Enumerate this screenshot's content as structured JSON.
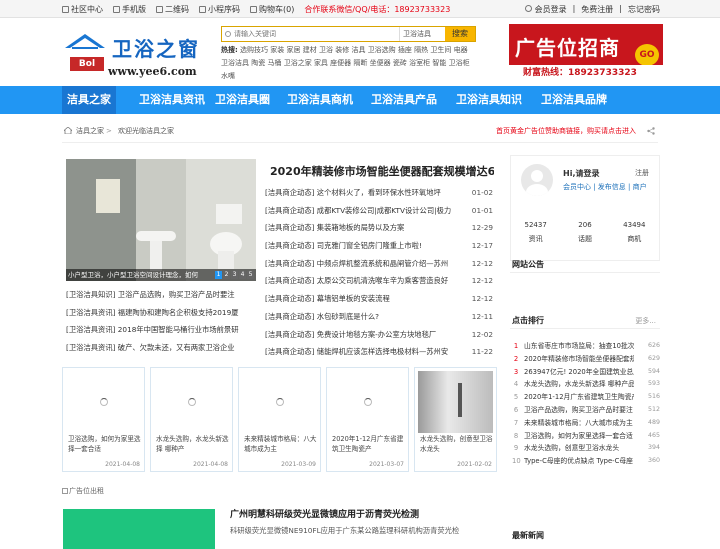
{
  "topbar": {
    "left": [
      "社区中心",
      "手机版",
      "二维码",
      "小程序码",
      "购物车(0)"
    ],
    "hotline": "合作联系微信/QQ/电话：18923733323",
    "right": [
      "会员登录",
      "免费注册",
      "忘记密码"
    ]
  },
  "logo": {
    "name": "卫浴之窗",
    "url": "www.yee6.com",
    "badge": "Bol"
  },
  "search": {
    "placeholder": "请输入关键词",
    "category": "卫浴洁具",
    "button": "搜索"
  },
  "hot": {
    "label": "热搜:",
    "items": [
      "选购技巧",
      "家装",
      "家居",
      "建材",
      "卫浴",
      "装修",
      "洁具",
      "卫浴选购",
      "插座",
      "隔热",
      "卫生间",
      "电器",
      "卫浴洁具",
      "陶瓷",
      "马桶",
      "卫浴之家",
      "家具",
      "座便器",
      "隔断",
      "坐便器",
      "瓷砖",
      "浴室柜",
      "智能",
      "卫浴柜",
      "水嘴"
    ]
  },
  "ad_banner": {
    "title": "广告位招商",
    "phone": "财富热线：18923733323",
    "go": "GO"
  },
  "nav": [
    "洁具之家",
    "卫浴洁具资讯",
    "卫浴洁具圈",
    "卫浴洁具商机",
    "卫浴洁具产品",
    "卫浴洁具知识",
    "卫浴洁具品牌"
  ],
  "breadcrumb": {
    "home": "洁具之家",
    "sep": ">",
    "current": "欢迎光临洁具之家",
    "ad": "首页黄金广告位赞助商链接，购买请点击进入"
  },
  "slide": {
    "caption": "小户型卫浴，小户型卫浴空间设计理念，如何",
    "dots": [
      "1",
      "2",
      "3",
      "4",
      "5"
    ]
  },
  "headline": "2020年精装修市场智能坐便器配套规模增达6",
  "news": [
    {
      "title": "[洁具商企动态] 这个材料火了，看到环保水性环氧地坪",
      "date": "01-02"
    },
    {
      "title": "[洁具商企动态] 成都KTV装修公司|成都KTV设计公司|极力",
      "date": "01-01"
    },
    {
      "title": "[洁具商企动态] 集装箱地板的局势以及方案",
      "date": "12-29"
    },
    {
      "title": "[洁具商企动态] 司克雅门窗全铝房门隆重上市啦!",
      "date": "12-17"
    },
    {
      "title": "[洁具商企动态] 中频点焊机整流系统和晶闸管介绍—苏州",
      "date": "12-12"
    },
    {
      "title": "[洁具商企动态] 太原公交司机清洗喉车辛为乘客营造良好",
      "date": "12-12"
    },
    {
      "title": "[洁具商企动态] 幕墙铝单板的安装流程",
      "date": "12-12"
    },
    {
      "title": "[洁具商企动态] 水包砂到底是什么?",
      "date": "12-11"
    },
    {
      "title": "[洁具商企动态] 免费设计地毯方案-办公室方块地毯厂",
      "date": "12-02"
    },
    {
      "title": "[洁具商企动态] 储能焊机应该怎样选择电极材料—苏州安",
      "date": "11-22"
    }
  ],
  "left_news": [
    "[卫浴洁具知识] 卫浴产品选购，购买卫浴产品时要注",
    "[卫浴洁具资讯] 福建陶协和建陶名企积极支持2019厦",
    "[卫浴洁具资讯] 2018年中国智能马桶行业市场前景研",
    "[卫浴洁具资讯] 破产、欠款未还，又有两家卫浴企业"
  ],
  "cards": [
    {
      "title": "卫浴选购，如何为家里选择一套合适",
      "date": "2021-04-08"
    },
    {
      "title": "水龙头选购，水龙头新选择 哪种产",
      "date": "2021-04-08"
    },
    {
      "title": "未来精装城市格局：八大城市成为主",
      "date": "2021-03-09"
    },
    {
      "title": "2020年1-12月广东省建筑卫生陶瓷产",
      "date": "2021-03-07"
    },
    {
      "title": "水龙头选购，创意型卫浴水龙头",
      "date": "2021-02-02"
    }
  ],
  "ad_placeholder": "广告位出租",
  "bottom_article": {
    "title": "广州明慧科研级荧光显微镜应用于沥青荧光检测",
    "desc": "科研级荧光显微镜NE910FL应用于广东某公路监理科研机构沥青荧光检"
  },
  "user": {
    "greeting": "Hi,请登录",
    "register": "注册",
    "links": "会员中心 | 发布信息 | 商户",
    "stats": [
      {
        "value": "52437",
        "label": "资讯"
      },
      {
        "value": "206",
        "label": "话题"
      },
      {
        "value": "43494",
        "label": "商机"
      }
    ]
  },
  "notice_title": "网站公告",
  "rank": {
    "title": "点击排行",
    "more": "更多...",
    "items": [
      {
        "n": "1",
        "title": "山东省枣庄市市场监局：抽查10批次节",
        "count": "626"
      },
      {
        "n": "2",
        "title": "2020年精装修市场智能坐便器配套规",
        "count": "629"
      },
      {
        "n": "3",
        "title": "263947亿元! 2020年全国建筑业总产",
        "count": "594"
      },
      {
        "n": "4",
        "title": "水龙头选购，水龙头新选择 哪种产品",
        "count": "593"
      },
      {
        "n": "5",
        "title": "2020年1-12月广东省建筑卫生陶瓷产",
        "count": "516"
      },
      {
        "n": "6",
        "title": "卫浴产品选购，购买卫浴产品时要注",
        "count": "512"
      },
      {
        "n": "7",
        "title": "未来精装城市格局：八大城市成为主",
        "count": "489"
      },
      {
        "n": "8",
        "title": "卫浴选购，如何为家里选择一套合适",
        "count": "465"
      },
      {
        "n": "9",
        "title": "水龙头选购，创意型卫浴水龙头",
        "count": "394"
      },
      {
        "n": "10",
        "title": "Type-C母座的优点缺点 Type-C母座",
        "count": "360"
      }
    ]
  },
  "latest_title": "最新新闻"
}
